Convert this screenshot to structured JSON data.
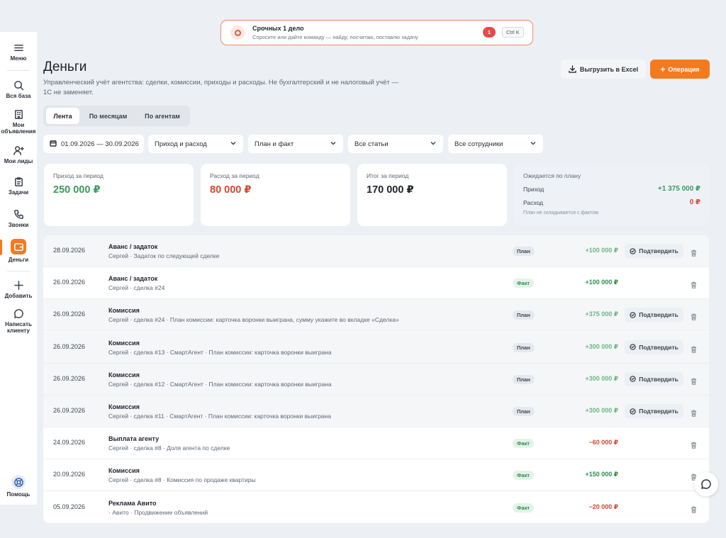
{
  "colors": {
    "accent": "#f47a20",
    "income": "#3a9a5c",
    "expense": "#d9442c",
    "banner_border": "#f08a6a"
  },
  "sidebar": {
    "items": [
      {
        "label": "Меню",
        "icon": "hamburger-icon"
      },
      {
        "label": "Вся база",
        "icon": "search-icon"
      },
      {
        "label": "Мои объявления",
        "icon": "building-icon"
      },
      {
        "label": "Мои лиды",
        "icon": "user-plus-icon"
      },
      {
        "label": "Задачи",
        "icon": "clipboard-icon"
      },
      {
        "label": "Звонки",
        "icon": "phone-icon"
      },
      {
        "label": "Деньги",
        "icon": "wallet-icon",
        "active": true
      },
      {
        "label": "Добавить",
        "icon": "plus-icon"
      },
      {
        "label": "Написать клиенту",
        "icon": "chat-icon"
      },
      {
        "label": "Помощь",
        "icon": "lifebuoy-icon"
      }
    ]
  },
  "banner": {
    "title": "Срочных 1 дело",
    "subtitle": "Спросите или дайте команду — найду, посчитаю, поставлю задачу",
    "count": "1",
    "shortcut": "Ctrl K"
  },
  "header": {
    "title": "Деньги",
    "subtitle": "Управленческий учёт агентства: сделки, комиссии, приходы и расходы. Не бухгалтерский и не налоговый учёт — 1С не заменяет.",
    "export_label": "Выгрузить в Excel",
    "add_label": "Операция"
  },
  "tabs": [
    {
      "label": "Лента",
      "active": true
    },
    {
      "label": "По месяцам"
    },
    {
      "label": "По агентам"
    }
  ],
  "filters": {
    "period": "01.09.2026 — 30.09.2026",
    "type": "Приход и расход",
    "mode": "План и факт",
    "category": "Все статьи",
    "employee": "Все сотрудники"
  },
  "summary": {
    "income": {
      "label": "Приход за период",
      "value": "250 000 ₽"
    },
    "expense": {
      "label": "Расход за период",
      "value": "80 000 ₽"
    },
    "total": {
      "label": "Итог за период",
      "value": "170 000 ₽"
    },
    "plan": {
      "title": "Ожидается по плану",
      "income_label": "Приход",
      "income_value": "+1 375 000 ₽",
      "expense_label": "Расход",
      "expense_value": "0 ₽",
      "note": "План не складывается с фактом"
    }
  },
  "confirm_label": "Подтвердить",
  "rows": [
    {
      "date": "28.09.2026",
      "title": "Аванс / задаток",
      "desc": "Сергей · Задаток по следующей сделке",
      "status": "План",
      "amount": "+100 000 ₽",
      "kind": "plan"
    },
    {
      "date": "26.09.2026",
      "title": "Аванс / задаток",
      "desc": "Сергей · сделка #24",
      "status": "Факт",
      "amount": "+100 000 ₽",
      "kind": "fact-in"
    },
    {
      "date": "26.09.2026",
      "title": "Комиссия",
      "desc": "Сергей · сделка #24 · План комиссии: карточка воронки выиграна, сумму укажите во вкладке «Сделка»",
      "status": "План",
      "amount": "+375 000 ₽",
      "kind": "plan"
    },
    {
      "date": "26.09.2026",
      "title": "Комиссия",
      "desc": "Сергей · сделка #13 · СмартАгент · План комиссии: карточка воронки выиграна",
      "status": "План",
      "amount": "+300 000 ₽",
      "kind": "plan"
    },
    {
      "date": "26.09.2026",
      "title": "Комиссия",
      "desc": "Сергей · сделка #12 · СмартАгент · План комиссии: карточка воронки выиграна",
      "status": "План",
      "amount": "+300 000 ₽",
      "kind": "plan"
    },
    {
      "date": "26.09.2026",
      "title": "Комиссия",
      "desc": "Сергей · сделка #11 · СмартАгент · План комиссии: карточка воронки выиграна",
      "status": "План",
      "amount": "+300 000 ₽",
      "kind": "plan"
    },
    {
      "date": "24.09.2026",
      "title": "Выплата агенту",
      "desc": "Сергей · сделка #8 · Доля агента по сделке",
      "status": "Факт",
      "amount": "−60 000 ₽",
      "kind": "fact-out"
    },
    {
      "date": "20.09.2026",
      "title": "Комиссия",
      "desc": "Сергей · сделка #8 · Комиссия по продаже квартиры",
      "status": "Факт",
      "amount": "+150 000 ₽",
      "kind": "fact-in"
    },
    {
      "date": "05.09.2026",
      "title": "Реклама Авито",
      "desc": "· Авито · Продвижение объявлений",
      "status": "Факт",
      "amount": "−20 000 ₽",
      "kind": "fact-out"
    }
  ]
}
